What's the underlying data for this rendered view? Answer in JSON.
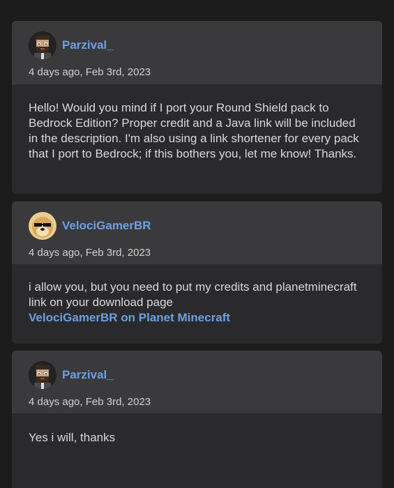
{
  "comments": [
    {
      "username": "Parzival_",
      "timestamp": "4 days ago, Feb 3rd, 2023",
      "avatar_icon": "pixel-bearded-man-avatar",
      "body": "Hello! Would you mind if I port your Round Shield pack to Bedrock Edition? Proper credit and a Java link will be included in the description. I'm also using a link shortener for every pack that I port to Bedrock; if this bothers you, let me know! Thanks."
    },
    {
      "username": "VelociGamerBR",
      "timestamp": "4 days ago, Feb 3rd, 2023",
      "avatar_icon": "doge-sunglasses-avatar",
      "body": "i allow you, but you need to put my credits and planetminecraft link on your download page",
      "link_text": "VelociGamerBR on Planet Minecraft"
    },
    {
      "username": "Parzival_",
      "timestamp": "4 days ago, Feb 3rd, 2023",
      "avatar_icon": "pixel-bearded-man-avatar",
      "body": "Yes i will, thanks"
    }
  ],
  "colors": {
    "background": "#1c1c1d",
    "card_header": "#3a3a3c",
    "card_body": "#2a2a2c",
    "username": "#6f9fe3",
    "text": "#d9d9d9"
  }
}
